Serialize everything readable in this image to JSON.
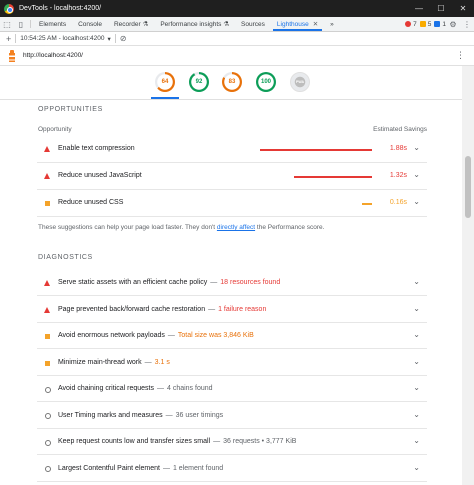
{
  "window": {
    "title": "DevTools - localhost:4200/",
    "minimize": "—",
    "maximize": "☐",
    "close": "✕"
  },
  "tabs": [
    {
      "label": "Elements"
    },
    {
      "label": "Console"
    },
    {
      "label": "Recorder",
      "suffix": "⚗"
    },
    {
      "label": "Performance insights",
      "suffix": "⚗"
    },
    {
      "label": "Sources"
    },
    {
      "label": "Lighthouse",
      "active": true
    }
  ],
  "badges": {
    "errors": "7",
    "warnings": "5",
    "info": "1"
  },
  "toolbar": {
    "plus": "+",
    "report": "10:54:25 AM - localhost:4200",
    "dropdown": "▾",
    "clear": "⊘"
  },
  "url": {
    "text": "http://localhost:4200/",
    "menu": "⋮"
  },
  "scores": [
    {
      "value": "64",
      "color": "#e8710a"
    },
    {
      "value": "92",
      "color": "#0c9d58"
    },
    {
      "value": "83",
      "color": "#e8710a"
    },
    {
      "value": "100",
      "color": "#0c9d58"
    },
    {
      "value": "PWA",
      "color": "#9e9e9e"
    }
  ],
  "opportunities": {
    "title": "OPPORTUNITIES",
    "col_left": "Opportunity",
    "col_right": "Estimated Savings",
    "rows": [
      {
        "label": "Enable text compression",
        "savings": "1.88s",
        "fraction": 1.0,
        "severity": "fail"
      },
      {
        "label": "Reduce unused JavaScript",
        "savings": "1.32s",
        "fraction": 0.7,
        "severity": "fail"
      },
      {
        "label": "Reduce unused CSS",
        "savings": "0.16s",
        "fraction": 0.09,
        "severity": "average"
      }
    ],
    "note_before": "These suggestions can help your page load faster. They don't ",
    "note_link": "directly affect",
    "note_after": " the Performance score."
  },
  "diagnostics": {
    "title": "DIAGNOSTICS",
    "rows": [
      {
        "label": "Serve static assets with an efficient cache policy",
        "detail": "18 resources found",
        "severity": "fail"
      },
      {
        "label": "Page prevented back/forward cache restoration",
        "detail": "1 failure reason",
        "severity": "fail"
      },
      {
        "label": "Avoid enormous network payloads",
        "detail": "Total size was 3,846 KiB",
        "severity": "average"
      },
      {
        "label": "Minimize main-thread work",
        "detail": "3.1 s",
        "severity": "average"
      },
      {
        "label": "Avoid chaining critical requests",
        "detail": "4 chains found",
        "severity": "info"
      },
      {
        "label": "User Timing marks and measures",
        "detail": "36 user timings",
        "severity": "info"
      },
      {
        "label": "Keep request counts low and transfer sizes small",
        "detail": "36 requests • 3,777 KiB",
        "severity": "info"
      },
      {
        "label": "Largest Contentful Paint element",
        "detail": "1 element found",
        "severity": "info"
      }
    ]
  },
  "colors": {
    "fail": "#e53935",
    "average": "#f4a32a",
    "accent": "#1a73e8"
  },
  "icons": {
    "chevron": "⌄",
    "dash": "—"
  }
}
